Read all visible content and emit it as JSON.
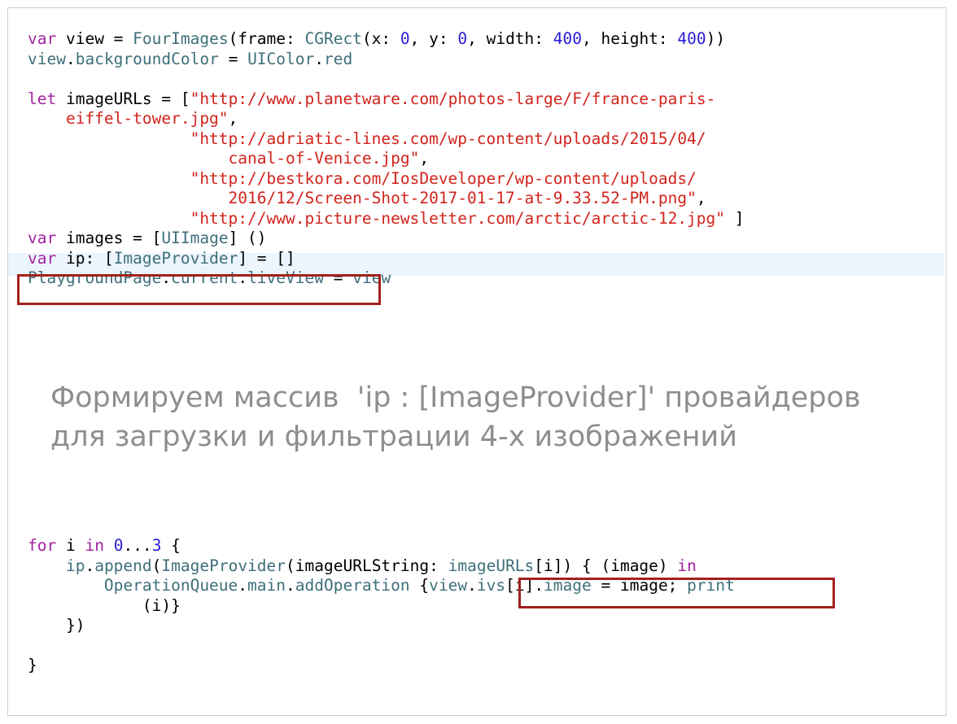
{
  "code_top": [
    [
      {
        "t": "var",
        "c": "kw"
      },
      {
        "t": " view = ",
        "c": ""
      },
      {
        "t": "FourImages",
        "c": "ty"
      },
      {
        "t": "(frame: ",
        "c": ""
      },
      {
        "t": "CGRect",
        "c": "ty"
      },
      {
        "t": "(x: ",
        "c": ""
      },
      {
        "t": "0",
        "c": "num"
      },
      {
        "t": ", y: ",
        "c": ""
      },
      {
        "t": "0",
        "c": "num"
      },
      {
        "t": ", width: ",
        "c": ""
      },
      {
        "t": "400",
        "c": "num"
      },
      {
        "t": ", height: ",
        "c": ""
      },
      {
        "t": "400",
        "c": "num"
      },
      {
        "t": "))",
        "c": ""
      }
    ],
    [
      {
        "t": "view",
        "c": "ty"
      },
      {
        "t": ".",
        "c": ""
      },
      {
        "t": "backgroundColor",
        "c": "ty"
      },
      {
        "t": " = ",
        "c": ""
      },
      {
        "t": "UIColor",
        "c": "ty"
      },
      {
        "t": ".",
        "c": ""
      },
      {
        "t": "red",
        "c": "ty"
      }
    ],
    [],
    [
      {
        "t": "let",
        "c": "kw"
      },
      {
        "t": " imageURLs = [",
        "c": ""
      },
      {
        "t": "\"http://www.planetware.com/photos-large/F/france-paris-",
        "c": "str"
      }
    ],
    [
      {
        "t": "    eiffel-tower.jpg\"",
        "c": "str"
      },
      {
        "t": ",",
        "c": ""
      }
    ],
    [
      {
        "t": "                 \"http://adriatic-lines.com/wp-content/uploads/2015/04/",
        "c": "str"
      }
    ],
    [
      {
        "t": "                     canal-of-Venice.jpg\"",
        "c": "str"
      },
      {
        "t": ",",
        "c": ""
      }
    ],
    [
      {
        "t": "                 \"http://bestkora.com/IosDeveloper/wp-content/uploads/",
        "c": "str"
      }
    ],
    [
      {
        "t": "                     2016/12/Screen-Shot-2017-01-17-at-9.33.52-PM.png\"",
        "c": "str"
      },
      {
        "t": ",",
        "c": ""
      }
    ],
    [
      {
        "t": "                 \"http://www.picture-newsletter.com/arctic/arctic-12.jpg\"",
        "c": "str"
      },
      {
        "t": " ]",
        "c": ""
      }
    ],
    [
      {
        "t": "var",
        "c": "kw"
      },
      {
        "t": " images = [",
        "c": ""
      },
      {
        "t": "UIImage",
        "c": "ty"
      },
      {
        "t": "] ()",
        "c": ""
      }
    ],
    [
      {
        "t": "var",
        "c": "kw"
      },
      {
        "t": " ip: [",
        "c": ""
      },
      {
        "t": "ImageProvider",
        "c": "ty"
      },
      {
        "t": "] = []",
        "c": ""
      }
    ],
    [
      {
        "t": "PlaygroundPage",
        "c": "ty"
      },
      {
        "t": ".",
        "c": ""
      },
      {
        "t": "current",
        "c": "ty"
      },
      {
        "t": ".",
        "c": ""
      },
      {
        "t": "liveView",
        "c": "ty"
      },
      {
        "t": " = ",
        "c": ""
      },
      {
        "t": "view",
        "c": "ty"
      }
    ]
  ],
  "caption": {
    "line1": "Формируем массив  'ip : [ImageProvider]' провайдеров",
    "line2": "для загрузки и фильтрации 4-х изображений"
  },
  "code_bottom": [
    [
      {
        "t": "for",
        "c": "kw"
      },
      {
        "t": " i ",
        "c": ""
      },
      {
        "t": "in",
        "c": "kw"
      },
      {
        "t": " ",
        "c": ""
      },
      {
        "t": "0",
        "c": "num"
      },
      {
        "t": "...",
        "c": ""
      },
      {
        "t": "3",
        "c": "num"
      },
      {
        "t": " {",
        "c": ""
      }
    ],
    [
      {
        "t": "    ",
        "c": ""
      },
      {
        "t": "ip",
        "c": "ty"
      },
      {
        "t": ".",
        "c": ""
      },
      {
        "t": "append",
        "c": "ty"
      },
      {
        "t": "(",
        "c": ""
      },
      {
        "t": "ImageProvider",
        "c": "ty"
      },
      {
        "t": "(imageURLString: ",
        "c": ""
      },
      {
        "t": "imageURLs",
        "c": "ty"
      },
      {
        "t": "[i]) { (image) ",
        "c": ""
      },
      {
        "t": "in",
        "c": "kw"
      }
    ],
    [
      {
        "t": "        ",
        "c": ""
      },
      {
        "t": "OperationQueue",
        "c": "ty"
      },
      {
        "t": ".",
        "c": ""
      },
      {
        "t": "main",
        "c": "ty"
      },
      {
        "t": ".",
        "c": ""
      },
      {
        "t": "addOperation",
        "c": "ty"
      },
      {
        "t": " {",
        "c": ""
      },
      {
        "t": "view",
        "c": "ty"
      },
      {
        "t": ".",
        "c": ""
      },
      {
        "t": "ivs",
        "c": "ty"
      },
      {
        "t": "[i].",
        "c": ""
      },
      {
        "t": "image",
        "c": "ty"
      },
      {
        "t": " = image; ",
        "c": ""
      },
      {
        "t": "print",
        "c": "ty"
      }
    ],
    [
      {
        "t": "            (i)}",
        "c": ""
      }
    ],
    [
      {
        "t": "    })",
        "c": ""
      }
    ],
    [],
    [
      {
        "t": "}",
        "c": ""
      }
    ]
  ],
  "colors": {
    "keyword": "#a2239f",
    "type": "#3e6f7a",
    "string": "#d1241d",
    "number": "#2a1bd6",
    "highlight_box": "#a3201c",
    "current_line": "#ecf5fd",
    "caption_text": "#8e8e8e"
  }
}
